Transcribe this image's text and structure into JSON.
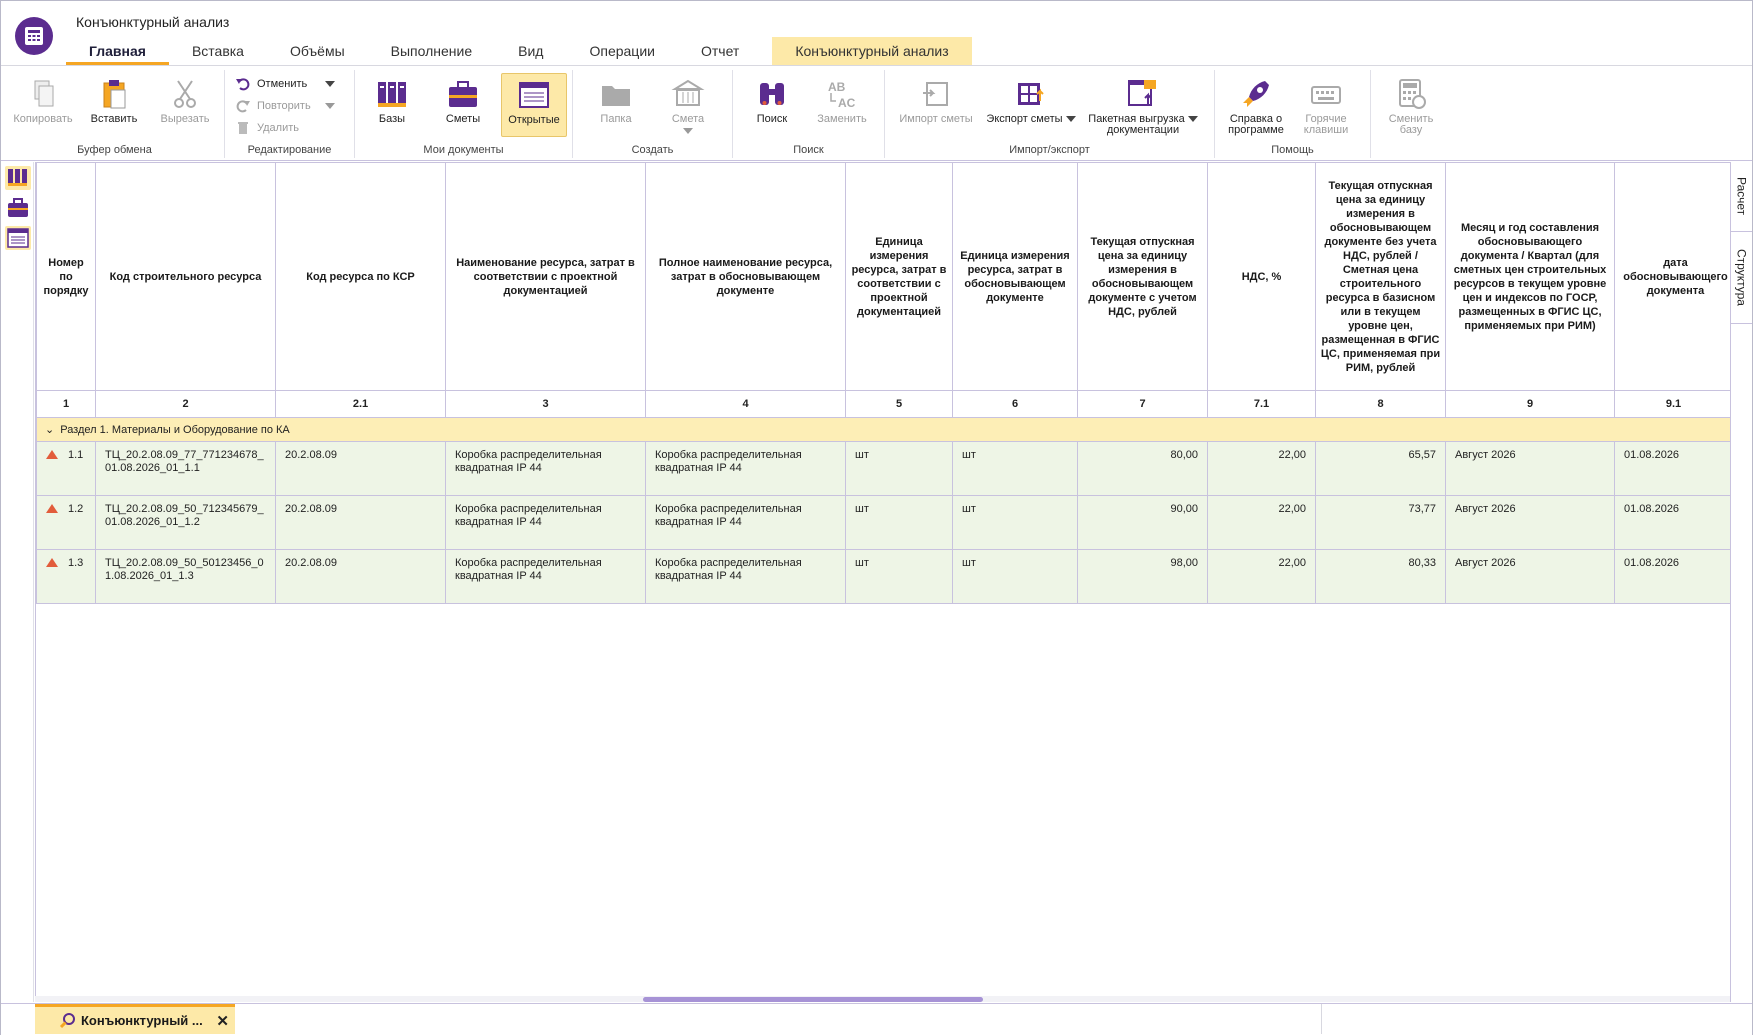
{
  "app": {
    "title": "Конъюнктурный анализ"
  },
  "tabs": [
    "Главная",
    "Вставка",
    "Объёмы",
    "Выполнение",
    "Вид",
    "Операции",
    "Отчет",
    "Конъюнктурный анализ"
  ],
  "ribbon": {
    "clipboard": {
      "label": "Буфер обмена",
      "copy": "Копировать",
      "paste": "Вставить",
      "cut": "Вырезать"
    },
    "editing": {
      "label": "Редактирование",
      "undo": "Отменить",
      "redo": "Повторить",
      "delete": "Удалить"
    },
    "mydocs": {
      "label": "Мои документы",
      "bases": "Базы",
      "estimates": "Сметы",
      "opened": "Открытые"
    },
    "create": {
      "label": "Создать",
      "folder": "Папка",
      "estimate": "Смета"
    },
    "search": {
      "label": "Поиск",
      "find": "Поиск",
      "replace": "Заменить"
    },
    "importexport": {
      "label": "Импорт/экспорт",
      "import": "Импорт сметы",
      "export": "Экспорт сметы",
      "batch_line1": "Пакетная выгрузка",
      "batch_line2": "документации"
    },
    "help": {
      "label": "Помощь",
      "about_line1": "Справка о",
      "about_line2": "программе",
      "hotkeys_line1": "Горячие",
      "hotkeys_line2": "клавиши"
    },
    "changebase": {
      "line1": "Сменить",
      "line2": "базу"
    }
  },
  "right_tabs": {
    "calc": "Расчет",
    "structure": "Структура"
  },
  "table": {
    "headers": [
      "Номер по порядку",
      "Код строительного ресурса",
      "Код ресурса по КСР",
      "Наименование ресурса, затрат в соответствии с проектной документацией",
      "Полное наименование ресурса, затрат в обосновывающем документе",
      "Единица измерения ресурса, затрат в соответствии с проектной документацией",
      "Единица измерения ресурса, затрат в обосновывающем документе",
      "Текущая отпускная цена за единицу измерения в обосновывающем документе с учетом НДС, рублей",
      "НДС, %",
      "Текущая отпускная цена за единицу измерения в обосновывающем документе без учета НДС, рублей / Сметная цена строительного ресурса в базисном или в текущем уровне цен, размещенная в ФГИС ЦС, применяемая при РИМ, рублей",
      "Месяц и год составления обосновывающего документа / Квартал (для сметных цен строительных ресурсов в текущем уровне цен и индексов по ГОСР, размещенных в ФГИС ЦС, применяемых при РИМ)",
      "дата обосновывающего документа"
    ],
    "numbers": [
      "1",
      "2",
      "2.1",
      "3",
      "4",
      "5",
      "6",
      "7",
      "7.1",
      "8",
      "9",
      "9.1"
    ],
    "section": "Раздел 1. Материалы и Оборудование по КА",
    "rows": [
      {
        "n": "1.1",
        "code": "ТЦ_20.2.08.09_77_771234678_01.08.2026_01_1.1",
        "ksr": "20.2.08.09",
        "name": "Коробка распределительная квадратная IP 44",
        "full": "Коробка распределительная квадратная IP 44",
        "unit": "шт",
        "unit2": "шт",
        "price": "80,00",
        "vat": "22,00",
        "net": "65,57",
        "month": "Август 2026",
        "date": "01.08.2026"
      },
      {
        "n": "1.2",
        "code": "ТЦ_20.2.08.09_50_712345679_01.08.2026_01_1.2",
        "ksr": "20.2.08.09",
        "name": "Коробка распределительная квадратная IP 44",
        "full": "Коробка распределительная квадратная IP 44",
        "unit": "шт",
        "unit2": "шт",
        "price": "90,00",
        "vat": "22,00",
        "net": "73,77",
        "month": "Август 2026",
        "date": "01.08.2026"
      },
      {
        "n": "1.3",
        "code": "ТЦ_20.2.08.09_50_50123456_01.08.2026_01_1.3",
        "ksr": "20.2.08.09",
        "name": "Коробка распределительная квадратная IP 44",
        "full": "Коробка распределительная квадратная IP 44",
        "unit": "шт",
        "unit2": "шт",
        "price": "98,00",
        "vat": "22,00",
        "net": "80,33",
        "month": "Август 2026",
        "date": "01.08.2026"
      }
    ]
  },
  "doc_tab": {
    "label": "Конъюнктурный ..."
  }
}
